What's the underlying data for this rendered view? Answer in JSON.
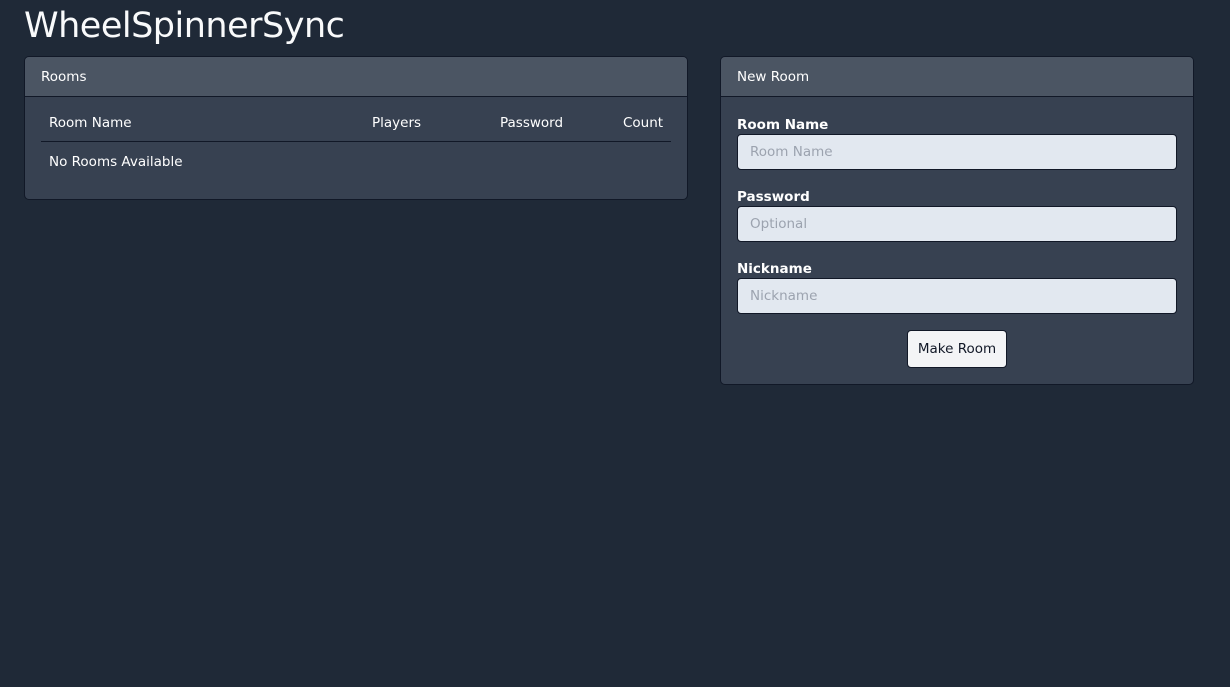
{
  "app": {
    "title": "WheelSpinnerSync"
  },
  "rooms": {
    "header": "Rooms",
    "columns": [
      "Room Name",
      "Players",
      "Password",
      "Count"
    ],
    "empty_message": "No Rooms Available"
  },
  "new_room": {
    "header": "New Room",
    "fields": {
      "room_name": {
        "label": "Room Name",
        "placeholder": "Room Name",
        "value": ""
      },
      "password": {
        "label": "Password",
        "placeholder": "Optional",
        "value": ""
      },
      "nickname": {
        "label": "Nickname",
        "placeholder": "Nickname",
        "value": ""
      }
    },
    "submit_label": "Make Room"
  },
  "colors": {
    "background": "#1f2937",
    "card": "#374151",
    "card_header": "#4b5563",
    "input": "#e2e8f0",
    "button": "#f3f4f6"
  }
}
